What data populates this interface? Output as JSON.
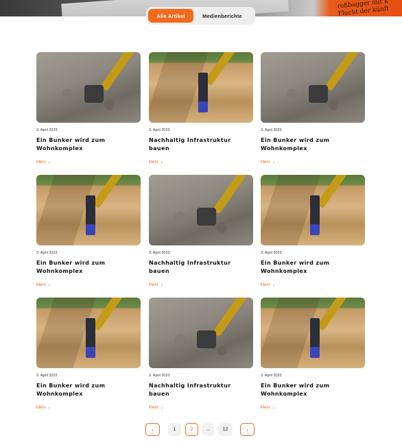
{
  "hero": {
    "text_lines": [
      "roßbagger mit k",
      "",
      "Flucht der künft"
    ]
  },
  "filter": {
    "tabs": [
      {
        "label": "Alle Artikel",
        "active": true
      },
      {
        "label": "Medienberichte",
        "active": false
      }
    ]
  },
  "articles": [
    {
      "date": "3. April 2023",
      "title": "Ein Bunker wird zum Wohnkomplex",
      "more": "Mehr"
    },
    {
      "date": "3. April 2023",
      "title": "Nachhaltig Infrastruktur bauen",
      "more": "Mehr"
    },
    {
      "date": "3. April 2023",
      "title": "Ein Bunker wird zum Wohnkomplex",
      "more": "Mehr"
    },
    {
      "date": "3. April 2023",
      "title": "Ein Bunker wird zum Wohnkomplex",
      "more": "Mehr"
    },
    {
      "date": "3. April 2023",
      "title": "Nachhaltig Infrastruktur bauen",
      "more": "Mehr"
    },
    {
      "date": "3. April 2023",
      "title": "Ein Bunker wird zum Wohnkomplex",
      "more": "Mehr"
    },
    {
      "date": "3. April 2023",
      "title": "Ein Bunker wird zum Wohnkomplex",
      "more": "Mehr"
    },
    {
      "date": "3. April 2023",
      "title": "Nachhaltig Infrastruktur bauen",
      "more": "Mehr"
    },
    {
      "date": "3. April 2023",
      "title": "Ein Bunker wird zum Wohnkomplex",
      "more": "Mehr"
    }
  ],
  "pagination": {
    "prev_icon": "chevron-left-icon",
    "next_icon": "chevron-right-icon",
    "pages": [
      "1",
      "2",
      "...",
      "12"
    ],
    "current": "2"
  },
  "colors": {
    "accent": "#f26a1b"
  }
}
